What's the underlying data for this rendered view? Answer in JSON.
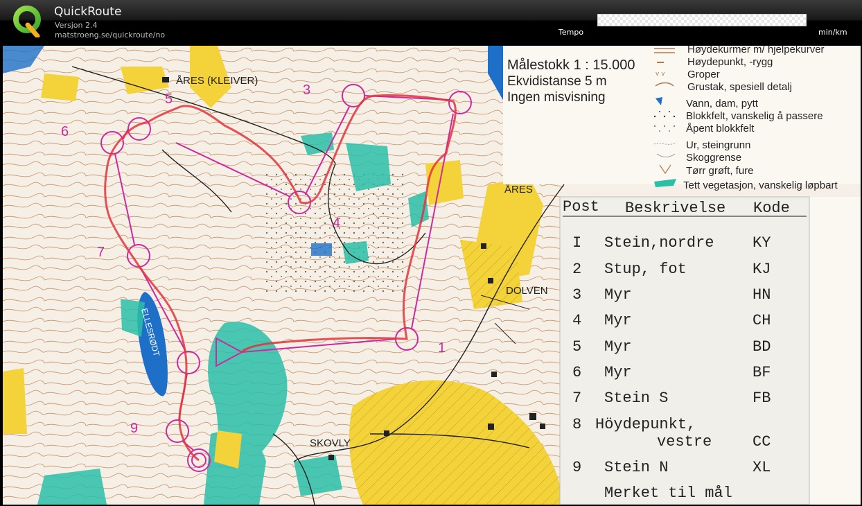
{
  "app": {
    "title": "QuickRoute",
    "version": "Versjon 2.4",
    "url": "matstroeng.se/quickroute/no"
  },
  "tempo": {
    "label": "Tempo",
    "unit": "min/km"
  },
  "map": {
    "place_names": [
      "ÅRES (KLEIVER)",
      "ÅRES",
      "DOLVEN",
      "SKOVLY",
      "ELLESRØDT"
    ],
    "control_numbers": [
      "1",
      "3",
      "4",
      "5",
      "6",
      "7",
      "9"
    ],
    "colors": {
      "route": "#e2323c",
      "course": "#cc2a9e",
      "water": "#1e6fc8",
      "vegetation": "#2bbfa8",
      "open": "#f3d23a"
    }
  },
  "legend": {
    "scale": "Målestokk 1 : 15.000",
    "equidistance": "Ekvidistanse 5 m",
    "declination": "Ingen misvisning",
    "symbols": [
      "Høydekurmer m/ hjelpekurver",
      "Høydepunkt, -rygg",
      "Groper",
      "Grustak, spesiell detalj",
      "Vann, dam, pytt",
      "Blokkfelt, vanskelig å passere",
      "Åpent blokkfelt",
      "Ur, steingrunn",
      "Skoggrense",
      "Tørr grøft, fure",
      "Tett vegetasjon, vanskelig løpbart"
    ]
  },
  "descriptions": {
    "headers": {
      "post": "Post",
      "desc": "Beskrivelse",
      "code": "Kode"
    },
    "rows": [
      {
        "post": "I",
        "desc": "Stein,nordre",
        "code": "KY"
      },
      {
        "post": "2",
        "desc": "Stup, fot",
        "code": "KJ"
      },
      {
        "post": "3",
        "desc": "Myr",
        "code": "HN"
      },
      {
        "post": "4",
        "desc": "Myr",
        "code": "CH"
      },
      {
        "post": "5",
        "desc": "Myr",
        "code": "BD"
      },
      {
        "post": "6",
        "desc": "Myr",
        "code": "BF"
      },
      {
        "post": "7",
        "desc": "Stein S",
        "code": "FB"
      },
      {
        "post": "8",
        "desc": "Höydepunkt,",
        "code": ""
      },
      {
        "post": "",
        "desc": "vestre",
        "code": "CC"
      },
      {
        "post": "9",
        "desc": "Stein N",
        "code": "XL"
      },
      {
        "post": "",
        "desc": "Merket til mål",
        "code": ""
      }
    ]
  }
}
